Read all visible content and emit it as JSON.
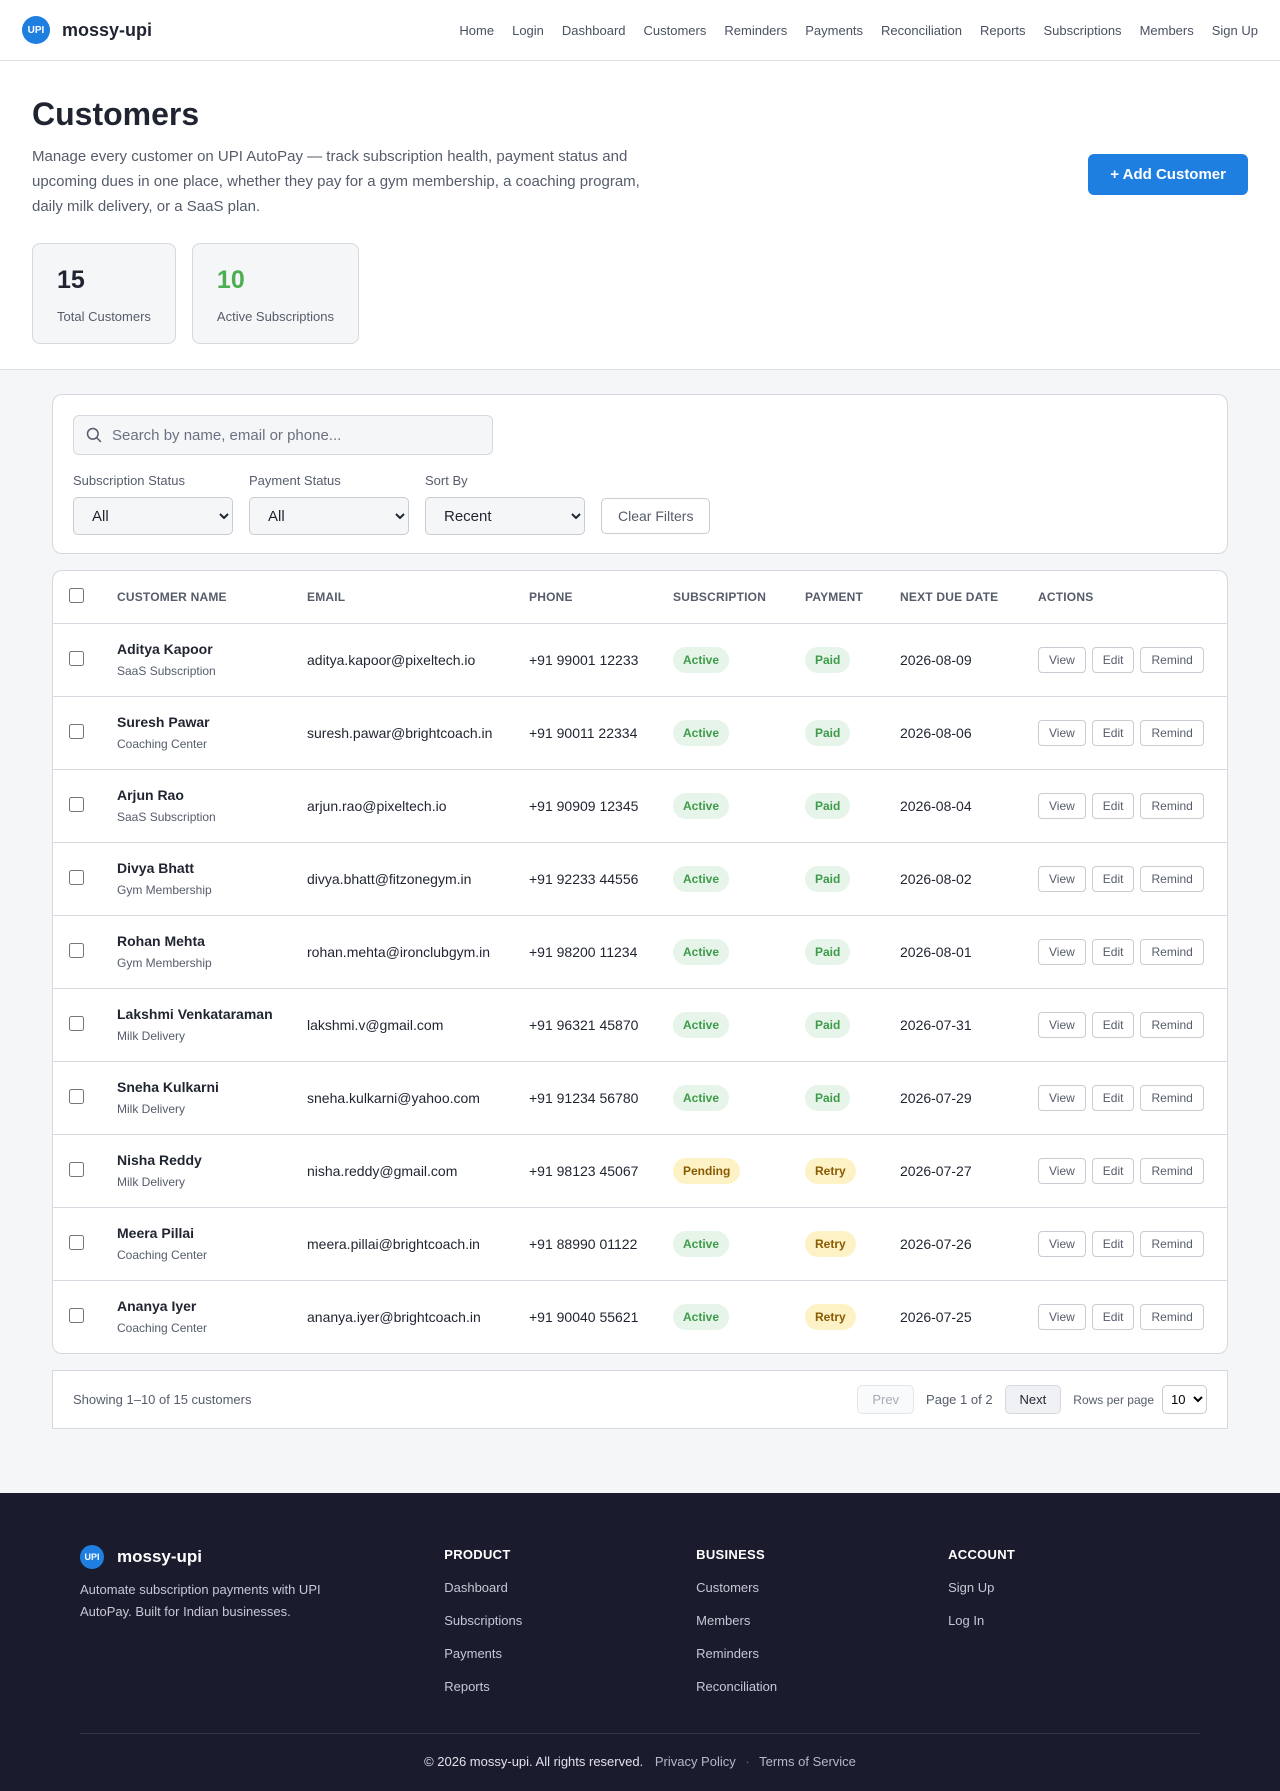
{
  "nav": {
    "logo_text": "UPI",
    "brand": "mossy-upi",
    "links": [
      "Home",
      "Login",
      "Dashboard",
      "Customers",
      "Reminders",
      "Payments",
      "Reconciliation",
      "Reports",
      "Subscriptions",
      "Members",
      "Sign Up"
    ]
  },
  "hero": {
    "title": "Customers",
    "description": "Manage every customer on UPI AutoPay — track subscription health, payment status and upcoming dues in one place, whether they pay for a gym membership, a coaching program, daily milk delivery, or a SaaS plan.",
    "add_button": "+ Add Customer",
    "stats": [
      {
        "value": "15",
        "label": "Total Customers"
      },
      {
        "value": "10",
        "label": "Active Subscriptions"
      }
    ]
  },
  "filters": {
    "search_placeholder": "Search by name, email or phone...",
    "subscription_status": {
      "label": "Subscription Status",
      "selected": "All"
    },
    "payment_status": {
      "label": "Payment Status",
      "selected": "All"
    },
    "sort_by": {
      "label": "Sort By",
      "selected": "Recent"
    },
    "clear_button": "Clear Filters"
  },
  "table": {
    "headers": [
      "Customer Name",
      "Email",
      "Phone",
      "Subscription",
      "Payment",
      "Next Due Date",
      "Actions"
    ],
    "action_labels": [
      "View",
      "Edit",
      "Remind"
    ],
    "rows": [
      {
        "name": "Aditya Kapoor",
        "type": "SaaS Subscription",
        "email": "aditya.kapoor@pixeltech.io",
        "phone": "+91 99001 12233",
        "subscription": "Active",
        "payment": "Paid",
        "due": "2026-08-09"
      },
      {
        "name": "Suresh Pawar",
        "type": "Coaching Center",
        "email": "suresh.pawar@brightcoach.in",
        "phone": "+91 90011 22334",
        "subscription": "Active",
        "payment": "Paid",
        "due": "2026-08-06"
      },
      {
        "name": "Arjun Rao",
        "type": "SaaS Subscription",
        "email": "arjun.rao@pixeltech.io",
        "phone": "+91 90909 12345",
        "subscription": "Active",
        "payment": "Paid",
        "due": "2026-08-04"
      },
      {
        "name": "Divya Bhatt",
        "type": "Gym Membership",
        "email": "divya.bhatt@fitzonegym.in",
        "phone": "+91 92233 44556",
        "subscription": "Active",
        "payment": "Paid",
        "due": "2026-08-02"
      },
      {
        "name": "Rohan Mehta",
        "type": "Gym Membership",
        "email": "rohan.mehta@ironclubgym.in",
        "phone": "+91 98200 11234",
        "subscription": "Active",
        "payment": "Paid",
        "due": "2026-08-01"
      },
      {
        "name": "Lakshmi Venkataraman",
        "type": "Milk Delivery",
        "email": "lakshmi.v@gmail.com",
        "phone": "+91 96321 45870",
        "subscription": "Active",
        "payment": "Paid",
        "due": "2026-07-31"
      },
      {
        "name": "Sneha Kulkarni",
        "type": "Milk Delivery",
        "email": "sneha.kulkarni@yahoo.com",
        "phone": "+91 91234 56780",
        "subscription": "Active",
        "payment": "Paid",
        "due": "2026-07-29"
      },
      {
        "name": "Nisha Reddy",
        "type": "Milk Delivery",
        "email": "nisha.reddy@gmail.com",
        "phone": "+91 98123 45067",
        "subscription": "Pending",
        "payment": "Retry",
        "due": "2026-07-27"
      },
      {
        "name": "Meera Pillai",
        "type": "Coaching Center",
        "email": "meera.pillai@brightcoach.in",
        "phone": "+91 88990 01122",
        "subscription": "Active",
        "payment": "Retry",
        "due": "2026-07-26"
      },
      {
        "name": "Ananya Iyer",
        "type": "Coaching Center",
        "email": "ananya.iyer@brightcoach.in",
        "phone": "+91 90040 55621",
        "subscription": "Active",
        "payment": "Retry",
        "due": "2026-07-25"
      }
    ]
  },
  "pagination": {
    "info": "Showing 1–10 of 15 customers",
    "prev": "Prev",
    "page": "Page 1 of 2",
    "next": "Next",
    "rows_label": "Rows per page",
    "rows_value": "10"
  },
  "footer": {
    "logo_text": "UPI",
    "brand": "mossy-upi",
    "description": "Automate subscription payments with UPI AutoPay. Built for Indian businesses.",
    "columns": [
      {
        "title": "Product",
        "links": [
          "Dashboard",
          "Subscriptions",
          "Payments",
          "Reports"
        ]
      },
      {
        "title": "Business",
        "links": [
          "Customers",
          "Members",
          "Reminders",
          "Reconciliation"
        ]
      },
      {
        "title": "Account",
        "links": [
          "Sign Up",
          "Log In"
        ]
      }
    ],
    "copyright": "© 2026 mossy-upi. All rights reserved.",
    "privacy": "Privacy Policy",
    "separator": "·",
    "terms": "Terms of Service"
  },
  "colors": {
    "accent": "#1e7fe0",
    "active_green": "#4caf50",
    "footer_bg": "#1b1b2e"
  }
}
